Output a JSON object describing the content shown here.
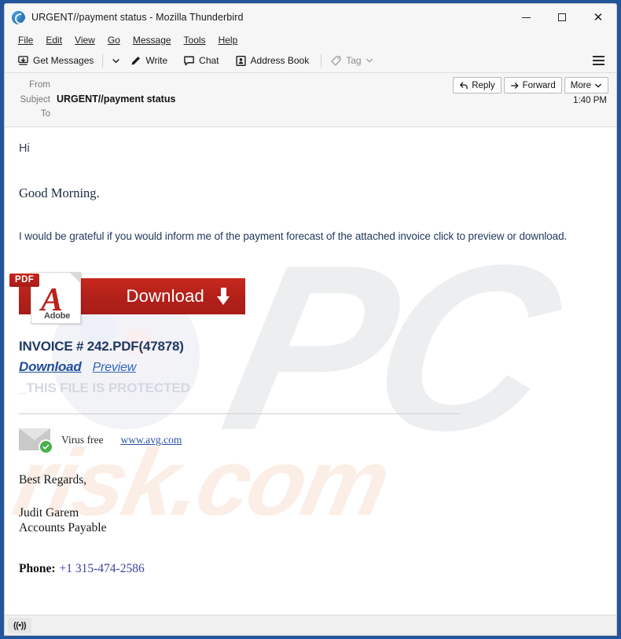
{
  "window": {
    "title": "URGENT//payment status - Mozilla Thunderbird",
    "logo_icon": "thunderbird-logo-icon",
    "controls": {
      "minimize": "minimize-icon",
      "maximize": "maximize-icon",
      "close": "close-icon"
    }
  },
  "menubar": {
    "items": [
      {
        "label": "File"
      },
      {
        "label": "Edit"
      },
      {
        "label": "View"
      },
      {
        "label": "Go"
      },
      {
        "label": "Message"
      },
      {
        "label": "Tools"
      },
      {
        "label": "Help"
      }
    ]
  },
  "toolbar": {
    "get_messages": "Get Messages",
    "get_messages_icon": "inbox-download-icon",
    "get_messages_dropdown_icon": "chevron-down-icon",
    "write": "Write",
    "write_icon": "pencil-icon",
    "chat": "Chat",
    "chat_icon": "speech-bubble-icon",
    "address_book": "Address Book",
    "address_book_icon": "address-book-icon",
    "tag": "Tag",
    "tag_icon": "tag-icon",
    "tag_dropdown_icon": "chevron-down-icon",
    "app_menu_icon": "hamburger-menu-icon"
  },
  "message_header": {
    "from_label": "From",
    "from_value": "",
    "subject_label": "Subject",
    "subject_value": "URGENT//payment status",
    "to_label": "To",
    "to_value": "",
    "time": "1:40 PM",
    "actions": {
      "reply": "Reply",
      "reply_icon": "reply-arrow-icon",
      "forward": "Forward",
      "forward_icon": "forward-arrow-icon",
      "more": "More",
      "more_icon": "chevron-down-icon"
    }
  },
  "body": {
    "greeting": "Hi",
    "salutation": "Good Morning.",
    "lead": "I would be grateful if you would inform me of the payment forecast of the attached invoice click to preview or download.",
    "attachment_banner": {
      "pdf_badge": "PDF",
      "adobe_label": "Adobe",
      "adobe_glyph": "A",
      "download_label": "Download",
      "download_arrow_icon": "down-arrow-icon"
    },
    "invoice_title": "INVOICE # 242.PDF(47878)",
    "download_link": "Download",
    "preview_link": "Preview",
    "protected_notice": "_THIS FILE IS PROTECTED",
    "avg": {
      "icon": "envelope-check-icon",
      "text": "Virus free",
      "link": "www.avg.com"
    },
    "signature": {
      "regards": "Best Regards,",
      "name": "Judit Garem",
      "role": "Accounts Payable",
      "phone_label": "Phone:",
      "phone_value": "+1 315-474-2586"
    },
    "watermarks": {
      "primary": "PC",
      "secondary": "risk.com"
    }
  },
  "statusbar": {
    "connection_icon": "connection-status-icon",
    "connection_glyph": "((•))"
  },
  "colors": {
    "window_border": "#23559b",
    "accent_red": "#b2211a",
    "link_blue": "#1f4e9c",
    "body_text": "#23395d",
    "protected_gray": "#d2d8e2"
  }
}
